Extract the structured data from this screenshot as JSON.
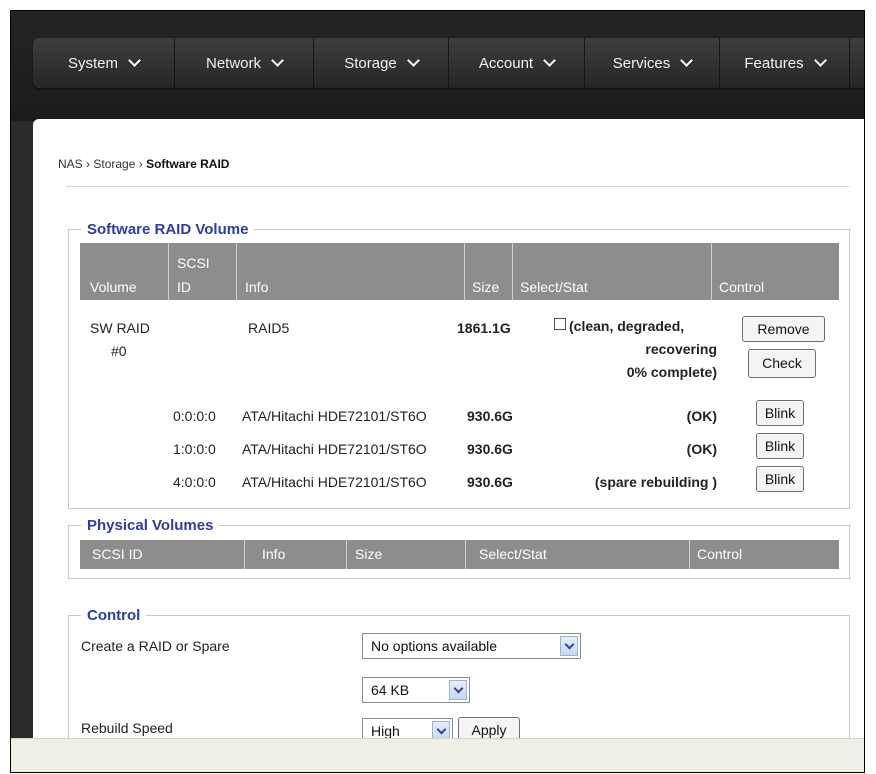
{
  "nav": {
    "items": [
      {
        "label": "System"
      },
      {
        "label": "Network"
      },
      {
        "label": "Storage"
      },
      {
        "label": "Account"
      },
      {
        "label": "Services"
      },
      {
        "label": "Features"
      }
    ]
  },
  "breadcrumb": {
    "root": "NAS",
    "section": "Storage",
    "current": "Software RAID",
    "sep": "›"
  },
  "raid": {
    "legend": "Software RAID Volume",
    "headers": {
      "volume": "Volume",
      "scsi_line1": "SCSI",
      "scsi_line2": "ID",
      "info": "Info",
      "size": "Size",
      "select": "Select/Stat",
      "control": "Control"
    },
    "volume": {
      "name_line1": "SW RAID",
      "name_line2": "#0",
      "info": "RAID5",
      "size": "1861.1G",
      "status_line1": "(clean, degraded,",
      "status_line2": "recovering",
      "status_line3": "0% complete)",
      "remove_label": "Remove",
      "check_label": "Check"
    },
    "members": [
      {
        "scsi": "0:0:0:0",
        "info": "ATA/Hitachi HDE72101/ST6O",
        "size": "930.6G",
        "status": "(OK)",
        "button": "Blink"
      },
      {
        "scsi": "1:0:0:0",
        "info": "ATA/Hitachi HDE72101/ST6O",
        "size": "930.6G",
        "status": "(OK)",
        "button": "Blink"
      },
      {
        "scsi": "4:0:0:0",
        "info": "ATA/Hitachi HDE72101/ST6O",
        "size": "930.6G",
        "status": "(spare rebuilding )",
        "button": "Blink"
      }
    ]
  },
  "physical": {
    "legend": "Physical Volumes",
    "headers": {
      "scsi": "SCSI ID",
      "info": "Info",
      "size": "Size",
      "select": "Select/Stat",
      "control": "Control"
    }
  },
  "control": {
    "legend": "Control",
    "create_label": "Create a RAID or Spare",
    "create_value": "No options available",
    "chunk_value": "64 KB",
    "rebuild_label": "Rebuild Speed",
    "rebuild_value": "High",
    "apply_label": "Apply"
  },
  "colors": {
    "legend": "#2e3d9e",
    "header_bg": "#8d8d8d",
    "nav_bg": "#2b2b2b"
  }
}
